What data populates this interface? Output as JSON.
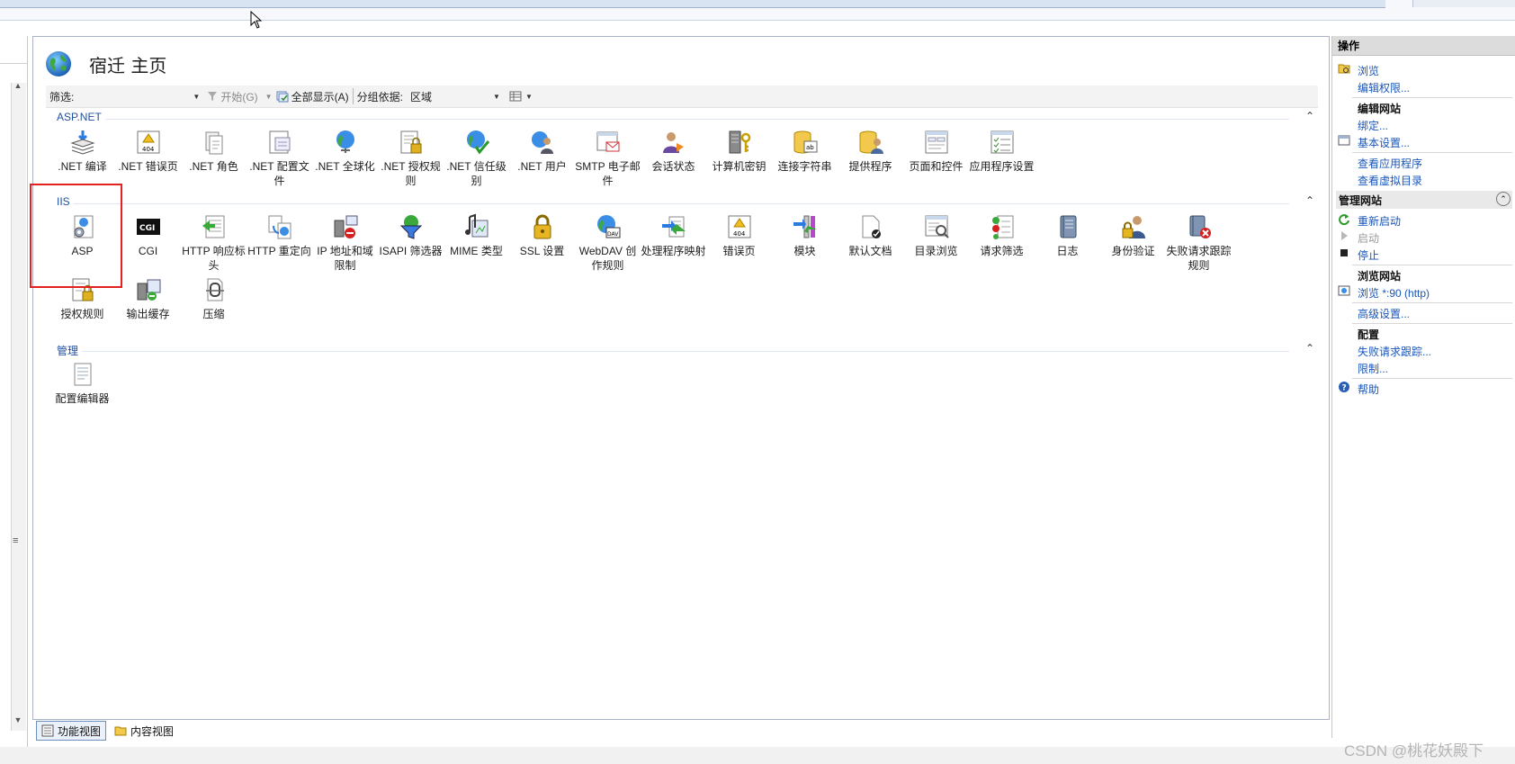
{
  "page_title": "宿迁 主页",
  "toolbar": {
    "filter_label": "筛选:",
    "filter_value": "",
    "start_label": "开始(G)",
    "show_all_label": "全部显示(A)",
    "group_by_label": "分组依据:",
    "group_by_value": "区域"
  },
  "groups": {
    "aspnet": {
      "title": "ASP.NET",
      "items": [
        {
          "label": ".NET 编译"
        },
        {
          "label": ".NET 错误页"
        },
        {
          "label": ".NET 角色"
        },
        {
          "label": ".NET 配置文件"
        },
        {
          "label": ".NET 全球化"
        },
        {
          "label": ".NET 授权规则"
        },
        {
          "label": ".NET 信任级别"
        },
        {
          "label": ".NET 用户"
        },
        {
          "label": "SMTP 电子邮件"
        },
        {
          "label": "会话状态"
        },
        {
          "label": "计算机密钥"
        },
        {
          "label": "连接字符串"
        },
        {
          "label": "提供程序"
        },
        {
          "label": "页面和控件"
        },
        {
          "label": "应用程序设置"
        }
      ]
    },
    "iis": {
      "title": "IIS",
      "items": [
        {
          "label": "ASP"
        },
        {
          "label": "CGI"
        },
        {
          "label": "HTTP 响应标头"
        },
        {
          "label": "HTTP 重定向"
        },
        {
          "label": "IP 地址和域限制"
        },
        {
          "label": "ISAPI 筛选器"
        },
        {
          "label": "MIME 类型"
        },
        {
          "label": "SSL 设置"
        },
        {
          "label": "WebDAV 创作规则"
        },
        {
          "label": "处理程序映射"
        },
        {
          "label": "错误页"
        },
        {
          "label": "模块"
        },
        {
          "label": "默认文档"
        },
        {
          "label": "目录浏览"
        },
        {
          "label": "请求筛选"
        },
        {
          "label": "日志"
        },
        {
          "label": "身份验证"
        },
        {
          "label": "失败请求跟踪规则"
        },
        {
          "label": "授权规则"
        },
        {
          "label": "输出缓存"
        },
        {
          "label": "压缩"
        }
      ]
    },
    "manage": {
      "title": "管理",
      "items": [
        {
          "label": "配置编辑器"
        }
      ]
    }
  },
  "bottom_tabs": {
    "features_view": "功能视图",
    "content_view": "内容视图"
  },
  "actions": {
    "header": "操作",
    "explore": "浏览",
    "edit_permissions": "编辑权限...",
    "edit_site_heading": "编辑网站",
    "bindings": "绑定...",
    "basic_settings": "基本设置...",
    "view_applications": "查看应用程序",
    "view_virtual_dirs": "查看虚拟目录",
    "manage_site_heading": "管理网站",
    "restart": "重新启动",
    "start": "启动",
    "stop": "停止",
    "browse_site_heading": "浏览网站",
    "browse_link": "浏览 *:90 (http)",
    "advanced_settings": "高级设置...",
    "configure_heading": "配置",
    "failed_request_tracing": "失败请求跟踪...",
    "limits": "限制...",
    "help": "帮助"
  },
  "watermark": "CSDN @桃花妖殿下",
  "colors": {
    "link": "#1a56b8",
    "group_title": "#1f4f9e",
    "highlight": "#e3221f"
  }
}
